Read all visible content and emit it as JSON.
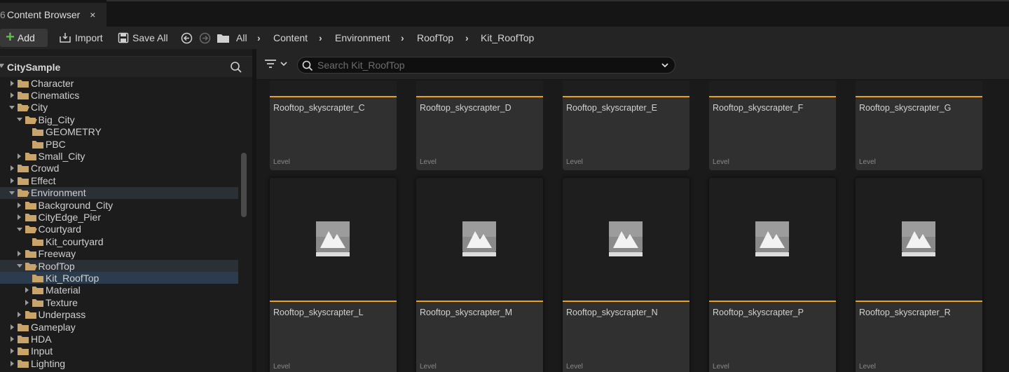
{
  "window": {
    "tab_label": "Content Browser",
    "tab_icon_glyph": "6",
    "close_glyph": "×"
  },
  "toolbar": {
    "add_label": "Add",
    "import_label": "Import",
    "save_all_label": "Save All"
  },
  "breadcrumb": [
    "All",
    "Content",
    "Environment",
    "RoofTop",
    "Kit_RoofTop"
  ],
  "tree": {
    "root": "CitySample",
    "items": [
      {
        "label": "Character",
        "depth": 1,
        "state": "collapsed"
      },
      {
        "label": "Cinematics",
        "depth": 1,
        "state": "collapsed"
      },
      {
        "label": "City",
        "depth": 1,
        "state": "expanded"
      },
      {
        "label": "Big_City",
        "depth": 2,
        "state": "expanded"
      },
      {
        "label": "GEOMETRY",
        "depth": 3,
        "state": "leaf"
      },
      {
        "label": "PBC",
        "depth": 3,
        "state": "leaf"
      },
      {
        "label": "Small_City",
        "depth": 2,
        "state": "collapsed"
      },
      {
        "label": "Crowd",
        "depth": 1,
        "state": "collapsed"
      },
      {
        "label": "Effect",
        "depth": 1,
        "state": "collapsed"
      },
      {
        "label": "Environment",
        "depth": 1,
        "state": "expanded"
      },
      {
        "label": "Background_City",
        "depth": 2,
        "state": "collapsed"
      },
      {
        "label": "CityEdge_Pier",
        "depth": 2,
        "state": "collapsed"
      },
      {
        "label": "Courtyard",
        "depth": 2,
        "state": "expanded"
      },
      {
        "label": "Kit_courtyard",
        "depth": 3,
        "state": "leaf"
      },
      {
        "label": "Freeway",
        "depth": 2,
        "state": "collapsed"
      },
      {
        "label": "RoofTop",
        "depth": 2,
        "state": "expanded"
      },
      {
        "label": "Kit_RoofTop",
        "depth": 3,
        "state": "leaf"
      },
      {
        "label": "Material",
        "depth": 3,
        "state": "collapsed"
      },
      {
        "label": "Texture",
        "depth": 3,
        "state": "collapsed"
      },
      {
        "label": "Underpass",
        "depth": 2,
        "state": "collapsed"
      },
      {
        "label": "Gameplay",
        "depth": 1,
        "state": "collapsed"
      },
      {
        "label": "HDA",
        "depth": 1,
        "state": "collapsed"
      },
      {
        "label": "Input",
        "depth": 1,
        "state": "collapsed"
      },
      {
        "label": "Lighting",
        "depth": 1,
        "state": "collapsed"
      }
    ],
    "selected": "Kit_RoofTop",
    "highlighted": [
      "Environment",
      "RoofTop"
    ]
  },
  "search": {
    "placeholder": "Search Kit_RoofTop"
  },
  "assets": {
    "row1": [
      {
        "name": "Rooftop_skyscrapter_C",
        "type": "Level"
      },
      {
        "name": "Rooftop_skyscrapter_D",
        "type": "Level"
      },
      {
        "name": "Rooftop_skyscrapter_E",
        "type": "Level"
      },
      {
        "name": "Rooftop_skyscrapter_F",
        "type": "Level"
      },
      {
        "name": "Rooftop_skyscrapter_G",
        "type": "Level"
      }
    ],
    "row2": [
      {
        "name": "Rooftop_skyscrapter_L",
        "type": "Level"
      },
      {
        "name": "Rooftop_skyscrapter_M",
        "type": "Level"
      },
      {
        "name": "Rooftop_skyscrapter_N",
        "type": "Level"
      },
      {
        "name": "Rooftop_skyscrapter_P",
        "type": "Level"
      },
      {
        "name": "Rooftop_skyscrapter_R",
        "type": "Level"
      }
    ]
  },
  "colors": {
    "accent_level": "#e9a31b",
    "selection": "#2b3c4e",
    "add_plus": "#58c243",
    "folder": "#c8a46a"
  }
}
